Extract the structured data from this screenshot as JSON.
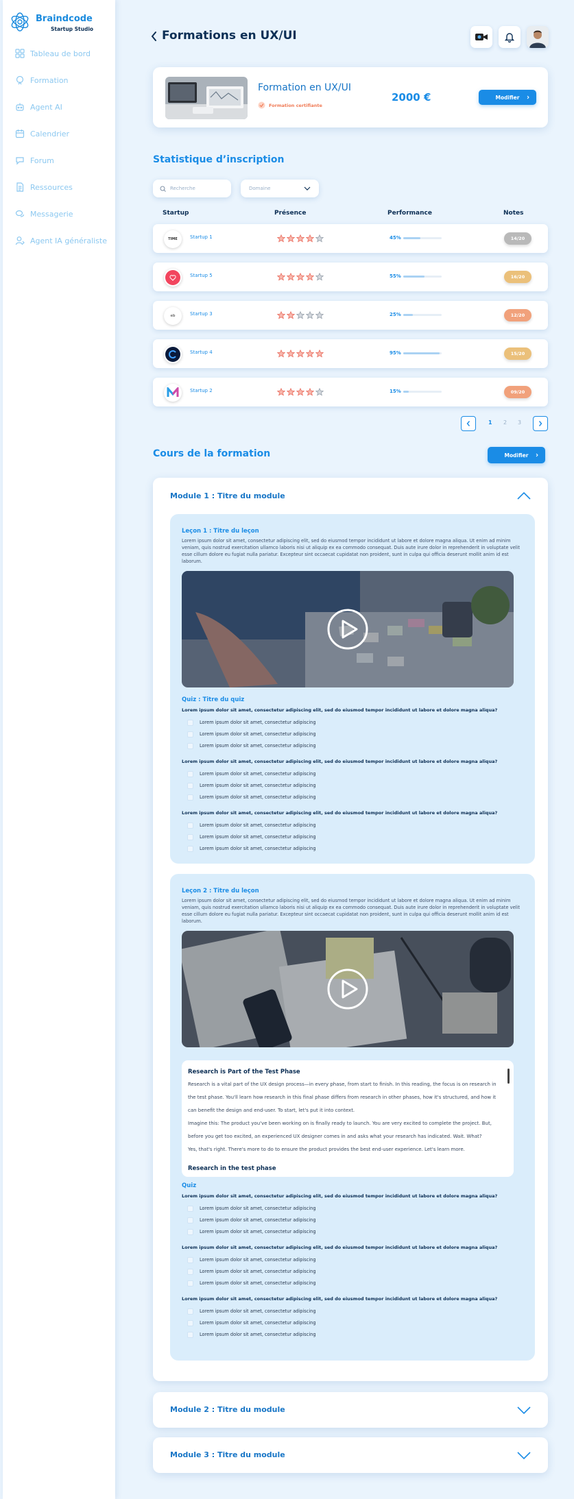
{
  "brand": {
    "name": "Braindcode",
    "subtitle": "Startup Studio"
  },
  "sidebar": {
    "items": [
      {
        "label": "Tableau de bord",
        "icon": "dashboard-icon"
      },
      {
        "label": "Formation",
        "icon": "formation-icon"
      },
      {
        "label": "Agent AI",
        "icon": "robot-icon"
      },
      {
        "label": "Calendrier",
        "icon": "calendar-icon"
      },
      {
        "label": "Forum",
        "icon": "forum-icon"
      },
      {
        "label": "Ressources",
        "icon": "document-icon"
      },
      {
        "label": "Messagerie",
        "icon": "chat-icon"
      },
      {
        "label": "Agent IA généraliste",
        "icon": "agent-icon"
      }
    ]
  },
  "header": {
    "title": "Formations en UX/UI"
  },
  "formation": {
    "name": "Formation en UX/UI",
    "certified": "Formation certifiante",
    "price": "2000 €",
    "edit_label": "Modifier"
  },
  "stats": {
    "title": "Statistique d’inscription",
    "search_placeholder": "Recherche",
    "domain_placeholder": "Domaine",
    "columns": [
      "Startup",
      "Présence",
      "Performance",
      "Notes"
    ],
    "rows": [
      {
        "logo": "TIME",
        "name": "Startup 1",
        "stars": 4,
        "performance": "45%",
        "perf_value": 0.45,
        "note": "14/20",
        "note_color": "#b9b9b9"
      },
      {
        "logo": "",
        "name": "Startup 5",
        "stars": 4,
        "performance": "55%",
        "perf_value": 0.55,
        "note": "16/20",
        "note_color": "#ebc07a"
      },
      {
        "logo": "eb",
        "name": "Startup 3",
        "stars": 2,
        "performance": "25%",
        "perf_value": 0.25,
        "note": "12/20",
        "note_color": "#f1a17b"
      },
      {
        "logo": "",
        "name": "Startup 4",
        "stars": 5,
        "performance": "95%",
        "perf_value": 0.95,
        "note": "15/20",
        "note_color": "#ebc07a"
      },
      {
        "logo": "",
        "name": "Startup 2",
        "stars": 4,
        "performance": "15%",
        "perf_value": 0.15,
        "note": "09/20",
        "note_color": "#f1a17b"
      }
    ],
    "pagination": {
      "pages": [
        "1",
        "2",
        "3"
      ],
      "current": "1"
    }
  },
  "course": {
    "title": "Cours de la formation",
    "edit_label": "Modifier",
    "module1": {
      "title": "Module 1 : Titre du module",
      "lesson1": {
        "title": "Leçon 1 : Titre du leçon",
        "text": "Lorem ipsum dolor sit amet, consectetur adipiscing elit, sed do eiusmod tempor incididunt ut labore et dolore magna aliqua. Ut enim ad minim veniam, quis nostrud exercitation ullamco laboris nisi ut aliquip ex ea commodo consequat. Duis aute irure dolor in reprehenderit in voluptate velit esse cillum dolore eu fugiat nulla pariatur. Excepteur sint occaecat cupidatat non proident, sunt in culpa qui officia deserunt mollit anim id est laborum.",
        "quiz_title": "Quiz : Titre du quiz",
        "question": "Lorem ipsum dolor sit amet, consectetur adipiscing elit, sed do eiusmod tempor incididunt ut labore et dolore magna aliqua?",
        "option": "Lorem ipsum dolor sit amet, consectetur adipiscing"
      },
      "lesson2": {
        "title": "Leçon 2 : Titre du leçon",
        "text": "Lorem ipsum dolor sit amet, consectetur adipiscing elit, sed do eiusmod tempor incididunt ut labore et dolore magna aliqua. Ut enim ad minim veniam, quis nostrud exercitation ullamco laboris nisi ut aliquip ex ea commodo consequat. Duis aute irure dolor in reprehenderit in voluptate velit esse cillum dolore eu fugiat nulla pariatur. Excepteur sint occaecat cupidatat non proident, sunt in culpa qui officia deserunt mollit anim id est laborum.",
        "reading": {
          "heading1": "Research is Part of the Test Phase",
          "para1": "Research is a vital part of the UX design process—in every phase, from start to finish. In this reading, the focus is on research in the test phase. You'll learn how research in this final phase differs from research in other phases, how it's structured, and how it can benefit the design and end-user. To start, let's put it into context.",
          "para2": "Imagine this: The product you've been working on is finally ready to launch. You are very excited to complete the project. But, before you get too excited, an experienced UX designer comes in and asks what your research has indicated. Wait. What?",
          "para3": "Yes, that's right. There's more to do to ensure the product provides the best end-user experience. Let's learn more.",
          "heading2": "Research in the test phase"
        },
        "quiz_title": "Quiz",
        "question": "Lorem ipsum dolor sit amet, consectetur adipiscing elit, sed do eiusmod tempor incididunt ut labore et dolore magna aliqua?",
        "option": "Lorem ipsum dolor sit amet, consectetur adipiscing"
      }
    },
    "module2": {
      "title": "Module 2 : Titre du module"
    },
    "module3": {
      "title": "Module 3 : Titre du module"
    }
  }
}
